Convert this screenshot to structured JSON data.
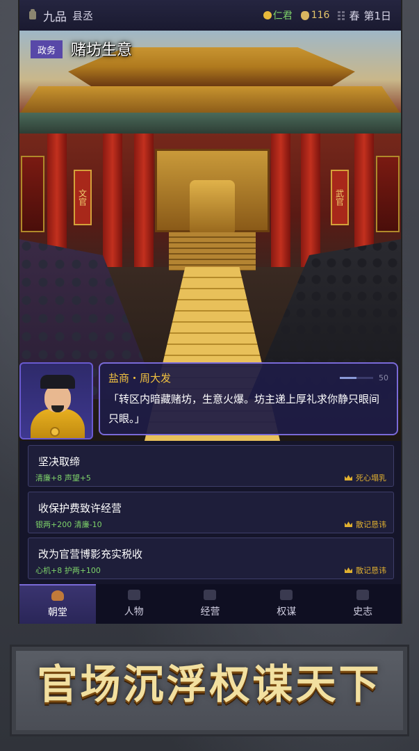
{
  "status": {
    "rank": "九品",
    "office": "县丞",
    "virtue": "仁君",
    "money": "116",
    "season": "春",
    "day": "第1日"
  },
  "event": {
    "tag": "政务",
    "title": "赌坊生意"
  },
  "scene": {
    "banner_left": "文官",
    "banner_right": "武官"
  },
  "dialog": {
    "speaker": "盐商・周大发",
    "meter_value": "50",
    "meter_fraction": 0.5,
    "text": "「转区内暗藏赌坊，生意火爆。坊主递上厚礼求你静只眼间只眼。」"
  },
  "choices": [
    {
      "label": "坚决取缔",
      "effects": "清廉+8  声望+5",
      "outcome": "死心塌乳"
    },
    {
      "label": "收保护费致许经营",
      "effects": "银两+200  清廉-10",
      "outcome": "散记恳讳"
    },
    {
      "label": "改为官营博影充实税收",
      "effects": "心机+8  护两+100",
      "outcome": "散记恳讳"
    }
  ],
  "tabs": [
    {
      "label": "朝堂",
      "icon": "court-icon",
      "active": true
    },
    {
      "label": "人物",
      "icon": "person-icon",
      "active": false
    },
    {
      "label": "经营",
      "icon": "flag-icon",
      "active": false
    },
    {
      "label": "权谋",
      "icon": "swords-icon",
      "active": false
    },
    {
      "label": "史志",
      "icon": "scroll-icon",
      "active": false
    }
  ],
  "slogan": "官场沉浮权谋天下",
  "colors": {
    "accent": "#7a6ad8",
    "positive": "#7ed46a",
    "gold": "#e0b030"
  }
}
